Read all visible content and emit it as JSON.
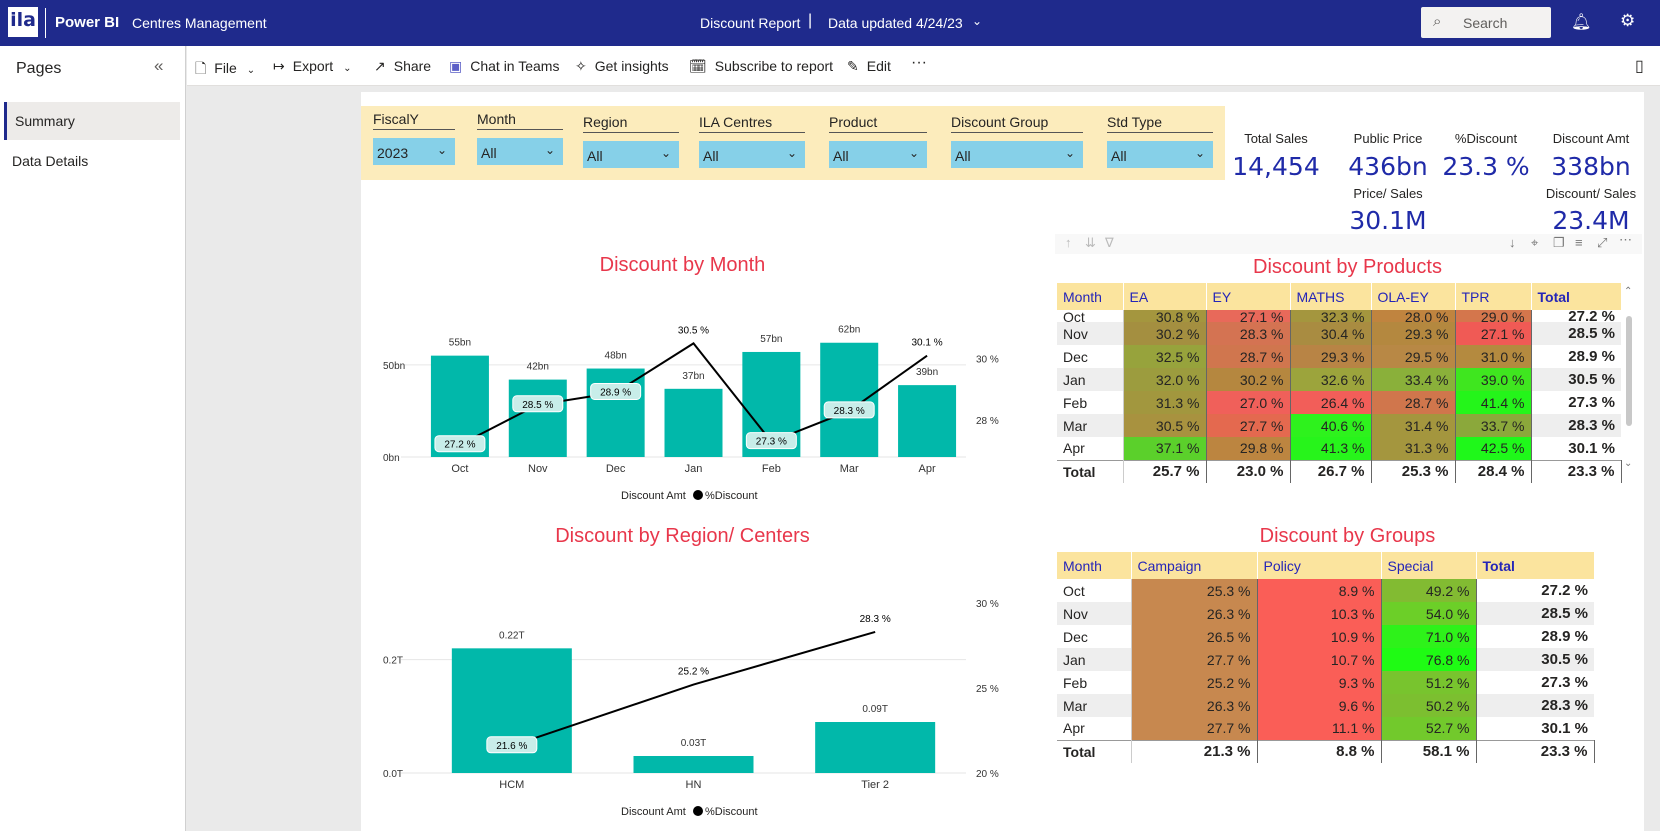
{
  "app": {
    "logo": "ila",
    "brand": "Power BI",
    "workspace": "Centres Management",
    "report_title": "Discount Report",
    "separator": "|",
    "data_updated": "Data updated 4/24/23",
    "search_placeholder": "Search"
  },
  "nav": {
    "heading": "Pages",
    "items": [
      "Summary",
      "Data Details"
    ]
  },
  "toolbar": {
    "file": "File",
    "export": "Export",
    "share": "Share",
    "chat": "Chat in Teams",
    "insights": "Get insights",
    "subscribe": "Subscribe to report",
    "edit": "Edit",
    "more": "···"
  },
  "slicers": [
    {
      "label": "FiscalY",
      "value": "2023"
    },
    {
      "label": "Month",
      "value": "All"
    },
    {
      "label": "Region",
      "value": "All"
    },
    {
      "label": "ILA Centres",
      "value": "All"
    },
    {
      "label": "Product",
      "value": "All"
    },
    {
      "label": "Discount Group",
      "value": "All"
    },
    {
      "label": "Std Type",
      "value": "All"
    }
  ],
  "kpis": {
    "total_sales": {
      "label": "Total Sales",
      "value": "14,454"
    },
    "public_price": {
      "label": "Public Price",
      "value": "436bn"
    },
    "discount_pct": {
      "label": "%Discount",
      "value": "23.3 %"
    },
    "discount_amt": {
      "label": "Discount Amt",
      "value": "338bn"
    },
    "price_sales": {
      "label": "Price/ Sales",
      "value": "30.1M"
    },
    "discount_sales": {
      "label": "Discount/ Sales",
      "value": "23.4M"
    }
  },
  "chart_data": [
    {
      "type": "bar",
      "title": "Discount by Month",
      "categories": [
        "Oct",
        "Nov",
        "Dec",
        "Jan",
        "Feb",
        "Mar",
        "Apr"
      ],
      "series": [
        {
          "name": "Discount Amt",
          "values": [
            55,
            42,
            48,
            37,
            57,
            62,
            39
          ],
          "labels": [
            "55bn",
            "42bn",
            "48bn",
            "37bn",
            "57bn",
            "62bn",
            "39bn"
          ],
          "color": "#01b8aa"
        },
        {
          "name": "%Discount",
          "type": "line",
          "values": [
            27.2,
            28.5,
            28.9,
            30.5,
            27.3,
            28.3,
            30.1
          ],
          "labels": [
            "27.2 %",
            "28.5 %",
            "28.9 %",
            "30.5 %",
            "27.3 %",
            "28.3 %",
            "30.1 %"
          ]
        }
      ],
      "y_ticks": [
        "0bn",
        "50bn"
      ],
      "y2_ticks": [
        "28 %",
        "30 %"
      ],
      "ylim": [
        0,
        70
      ],
      "y2lim": [
        26.8,
        31.0
      ],
      "legend": "bottom"
    },
    {
      "type": "bar",
      "title": "Discount by Region/ Centers",
      "categories": [
        "HCM",
        "HN",
        "Tier 2"
      ],
      "series": [
        {
          "name": "Discount Amt",
          "values": [
            0.22,
            0.03,
            0.09
          ],
          "labels": [
            "0.22T",
            "0.03T",
            "0.09T"
          ],
          "color": "#01b8aa"
        },
        {
          "name": "%Discount",
          "type": "line",
          "values": [
            21.6,
            25.2,
            28.3
          ],
          "labels": [
            "21.6 %",
            "25.2 %",
            "28.3 %"
          ]
        }
      ],
      "y_ticks": [
        "0.0T",
        "0.2T"
      ],
      "y2_ticks": [
        "20 %",
        "25 %",
        "30 %"
      ],
      "ylim": [
        0,
        0.3
      ],
      "y2lim": [
        20,
        30
      ],
      "legend": "bottom"
    }
  ],
  "products_table": {
    "title": "Discount by Products",
    "columns": [
      "Month",
      "EA",
      "EY",
      "MATHS",
      "OLA-EY",
      "TPR",
      "Total"
    ],
    "rows": [
      {
        "m": "Oct",
        "v": [
          "30.8 %",
          "27.1 %",
          "32.3 %",
          "28.0 %",
          "29.0 %",
          "27.2 %"
        ],
        "c": [
          "#a4963e",
          "#e8695a",
          "#a4963e",
          "#c0843f",
          "#d4764c"
        ]
      },
      {
        "m": "Nov",
        "v": [
          "30.2 %",
          "28.3 %",
          "30.4 %",
          "29.3 %",
          "27.1 %",
          "28.5 %"
        ],
        "c": [
          "#a48f40",
          "#d47352",
          "#a98c41",
          "#b4883f",
          "#f05a55"
        ]
      },
      {
        "m": "Dec",
        "v": [
          "32.5 %",
          "28.7 %",
          "29.3 %",
          "29.5 %",
          "31.0 %",
          "28.9 %"
        ],
        "c": [
          "#97a33c",
          "#d0764e",
          "#b88445",
          "#b88845",
          "#b48a3f"
        ]
      },
      {
        "m": "Jan",
        "v": [
          "32.0 %",
          "30.2 %",
          "32.6 %",
          "33.4 %",
          "39.0 %",
          "30.5 %"
        ],
        "c": [
          "#9c9c3e",
          "#b5873f",
          "#9ca43c",
          "#8ab03a",
          "#3fe61f"
        ]
      },
      {
        "m": "Feb",
        "v": [
          "31.3 %",
          "27.0 %",
          "26.4 %",
          "28.7 %",
          "41.4 %",
          "27.3 %"
        ],
        "c": [
          "#a2973e",
          "#f0605a",
          "#f25e59",
          "#d0764c",
          "#24f51a"
        ]
      },
      {
        "m": "Mar",
        "v": [
          "30.5 %",
          "27.7 %",
          "40.6 %",
          "31.4 %",
          "33.7 %",
          "28.3 %"
        ],
        "c": [
          "#a8923f",
          "#e4694f",
          "#2ef21d",
          "#a4963e",
          "#8ba83b"
        ]
      },
      {
        "m": "Apr",
        "v": [
          "37.1 %",
          "29.8 %",
          "41.3 %",
          "31.3 %",
          "42.5 %",
          "30.1 %"
        ],
        "c": [
          "#5bd02b",
          "#bc8540",
          "#27f41b",
          "#a4963e",
          "#1ff81a"
        ]
      }
    ],
    "total": {
      "m": "Total",
      "v": [
        "25.7 %",
        "23.0 %",
        "26.7 %",
        "25.3 %",
        "28.4 %",
        "23.3 %"
      ]
    }
  },
  "groups_table": {
    "title": "Discount by Groups",
    "columns": [
      "Month",
      "Campaign",
      "Policy",
      "Special",
      "Total"
    ],
    "rows": [
      {
        "m": "Oct",
        "v": [
          "25.3 %",
          "8.9 %",
          "49.2 %",
          "27.2 %"
        ],
        "c": [
          "#c7884f",
          "#fa5e57",
          "#82bb32"
        ]
      },
      {
        "m": "Nov",
        "v": [
          "26.3 %",
          "10.3 %",
          "54.0 %",
          "28.5 %"
        ],
        "c": [
          "#c7884f",
          "#fa5e57",
          "#6ccf28"
        ]
      },
      {
        "m": "Dec",
        "v": [
          "26.5 %",
          "10.9 %",
          "71.0 %",
          "28.9 %"
        ],
        "c": [
          "#c7884f",
          "#fa5e57",
          "#2ef21a"
        ]
      },
      {
        "m": "Jan",
        "v": [
          "27.7 %",
          "10.7 %",
          "76.8 %",
          "30.5 %"
        ],
        "c": [
          "#c7884f",
          "#fa5e57",
          "#1ffb14"
        ]
      },
      {
        "m": "Feb",
        "v": [
          "25.2 %",
          "9.3 %",
          "51.2 %",
          "27.3 %"
        ],
        "c": [
          "#c7884f",
          "#fa5e57",
          "#78c42e"
        ]
      },
      {
        "m": "Mar",
        "v": [
          "26.3 %",
          "9.6 %",
          "50.2 %",
          "28.3 %"
        ],
        "c": [
          "#c7884f",
          "#fa5e57",
          "#7cbf30"
        ]
      },
      {
        "m": "Apr",
        "v": [
          "27.7 %",
          "11.1 %",
          "52.7 %",
          "30.1 %"
        ],
        "c": [
          "#c7884f",
          "#fa5e57",
          "#72c92c"
        ]
      }
    ],
    "total": {
      "m": "Total",
      "v": [
        "21.3 %",
        "8.8 %",
        "58.1 %",
        "23.3 %"
      ]
    }
  }
}
